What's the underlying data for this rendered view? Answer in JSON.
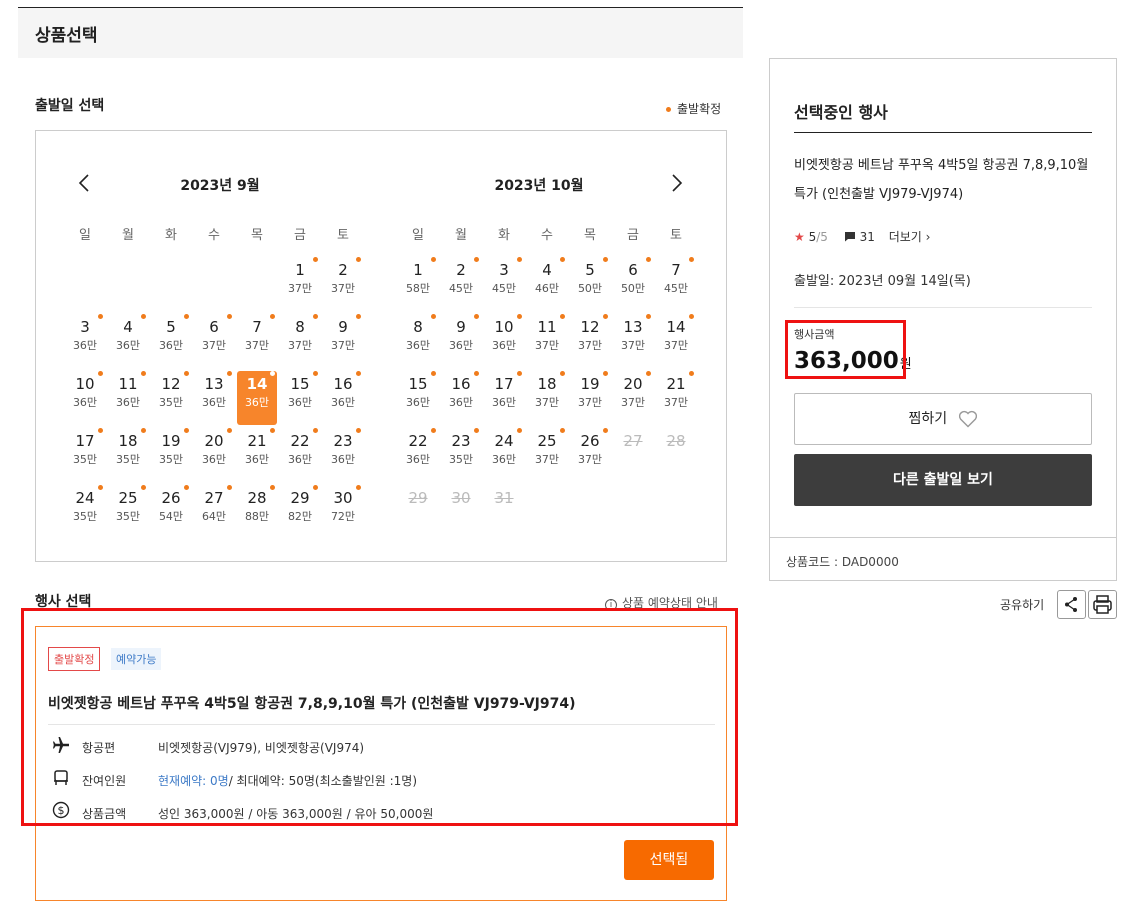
{
  "header": {
    "title": "상품선택"
  },
  "departure": {
    "label": "출발일 선택",
    "legend": "출발확정",
    "calendars": [
      {
        "title": "2023년 9월",
        "weekdays": [
          "일",
          "월",
          "화",
          "수",
          "목",
          "금",
          "토"
        ],
        "days": [
          {
            "day": "1",
            "price": "37만",
            "confirmed": true
          },
          {
            "day": "2",
            "price": "37만",
            "confirmed": true
          },
          {
            "day": "3",
            "price": "36만",
            "confirmed": true
          },
          {
            "day": "4",
            "price": "36만",
            "confirmed": true
          },
          {
            "day": "5",
            "price": "36만",
            "confirmed": true
          },
          {
            "day": "6",
            "price": "37만",
            "confirmed": true
          },
          {
            "day": "7",
            "price": "37만",
            "confirmed": true
          },
          {
            "day": "8",
            "price": "37만",
            "confirmed": true
          },
          {
            "day": "9",
            "price": "37만",
            "confirmed": true
          },
          {
            "day": "10",
            "price": "36만",
            "confirmed": true
          },
          {
            "day": "11",
            "price": "36만",
            "confirmed": true
          },
          {
            "day": "12",
            "price": "35만",
            "confirmed": true
          },
          {
            "day": "13",
            "price": "36만",
            "confirmed": true
          },
          {
            "day": "14",
            "price": "36만",
            "confirmed": true,
            "selected": true
          },
          {
            "day": "15",
            "price": "36만",
            "confirmed": true
          },
          {
            "day": "16",
            "price": "36만",
            "confirmed": true
          },
          {
            "day": "17",
            "price": "35만",
            "confirmed": true
          },
          {
            "day": "18",
            "price": "35만",
            "confirmed": true
          },
          {
            "day": "19",
            "price": "35만",
            "confirmed": true
          },
          {
            "day": "20",
            "price": "36만",
            "confirmed": true
          },
          {
            "day": "21",
            "price": "36만",
            "confirmed": true
          },
          {
            "day": "22",
            "price": "36만",
            "confirmed": true
          },
          {
            "day": "23",
            "price": "36만",
            "confirmed": true
          },
          {
            "day": "24",
            "price": "35만",
            "confirmed": true
          },
          {
            "day": "25",
            "price": "35만",
            "confirmed": true
          },
          {
            "day": "26",
            "price": "54만",
            "confirmed": true
          },
          {
            "day": "27",
            "price": "64만",
            "confirmed": true
          },
          {
            "day": "28",
            "price": "88만",
            "confirmed": true
          },
          {
            "day": "29",
            "price": "82만",
            "confirmed": true
          },
          {
            "day": "30",
            "price": "72만",
            "confirmed": true
          }
        ]
      },
      {
        "title": "2023년 10월",
        "weekdays": [
          "일",
          "월",
          "화",
          "수",
          "목",
          "금",
          "토"
        ],
        "days": [
          {
            "day": "1",
            "price": "58만",
            "confirmed": true
          },
          {
            "day": "2",
            "price": "45만",
            "confirmed": true
          },
          {
            "day": "3",
            "price": "45만",
            "confirmed": true
          },
          {
            "day": "4",
            "price": "46만",
            "confirmed": true
          },
          {
            "day": "5",
            "price": "50만",
            "confirmed": true
          },
          {
            "day": "6",
            "price": "50만",
            "confirmed": true
          },
          {
            "day": "7",
            "price": "45만",
            "confirmed": true
          },
          {
            "day": "8",
            "price": "36만",
            "confirmed": true
          },
          {
            "day": "9",
            "price": "36만",
            "confirmed": true
          },
          {
            "day": "10",
            "price": "36만",
            "confirmed": true
          },
          {
            "day": "11",
            "price": "37만",
            "confirmed": true
          },
          {
            "day": "12",
            "price": "37만",
            "confirmed": true
          },
          {
            "day": "13",
            "price": "37만",
            "confirmed": true
          },
          {
            "day": "14",
            "price": "37만",
            "confirmed": true
          },
          {
            "day": "15",
            "price": "36만",
            "confirmed": true
          },
          {
            "day": "16",
            "price": "36만",
            "confirmed": true
          },
          {
            "day": "17",
            "price": "36만",
            "confirmed": true
          },
          {
            "day": "18",
            "price": "37만",
            "confirmed": true
          },
          {
            "day": "19",
            "price": "37만",
            "confirmed": true
          },
          {
            "day": "20",
            "price": "37만",
            "confirmed": true
          },
          {
            "day": "21",
            "price": "37만",
            "confirmed": true
          },
          {
            "day": "22",
            "price": "36만",
            "confirmed": true
          },
          {
            "day": "23",
            "price": "35만",
            "confirmed": true
          },
          {
            "day": "24",
            "price": "36만",
            "confirmed": true
          },
          {
            "day": "25",
            "price": "37만",
            "confirmed": true
          },
          {
            "day": "26",
            "price": "37만",
            "confirmed": true
          },
          {
            "day": "27",
            "price": "",
            "disabled": true
          },
          {
            "day": "28",
            "price": "",
            "disabled": true
          },
          {
            "day": "29",
            "price": "",
            "disabled": true
          },
          {
            "day": "30",
            "price": "",
            "disabled": true
          },
          {
            "day": "31",
            "price": "",
            "disabled": true
          }
        ]
      }
    ]
  },
  "event_select": {
    "label": "행사 선택",
    "status_info": "상품 예약상태 안내",
    "tags": [
      "출발확정",
      "예약가능"
    ],
    "product_title": "비엣젯항공 베트남 푸꾸옥 4박5일 항공권 7,8,9,10월 특가 (인천출발 VJ979-VJ974)",
    "rows": {
      "flight_key": "항공편",
      "flight_value": "비엣젯항공(VJ979), 비엣젯항공(VJ974)",
      "seats_key": "잔여인원",
      "seats_current": "현재예약: 0명",
      "seats_rest": "/ 최대예약: 50명(최소출발인원 :1명)",
      "price_key": "상품금액",
      "price_value": "성인 363,000원 / 아동 363,000원 / 유아 50,000원"
    },
    "select_button": "선택됨"
  },
  "sidebar": {
    "title": "선택중인 행사",
    "product_name": "비엣젯항공 베트남 푸꾸옥 4박5일 항공권 7,8,9,10월 특가 (인천출발 VJ979-VJ974)",
    "rating": "5",
    "rating_max": "/5",
    "review_count": "31",
    "more": "더보기 ›",
    "departure_date": "출발일: 2023년 09월 14일(목)",
    "price_label": "행사금액",
    "price": "363,000",
    "price_unit": "원",
    "wish_button": "찜하기",
    "other_dates_button": "다른 출발일 보기",
    "product_code": "상품코드 : DAD0000"
  },
  "share": {
    "label": "공유하기"
  },
  "colors": {
    "accent": "#f7852b",
    "dot": "#f07c1c",
    "highlight_box": "#ee1111",
    "dark_button": "#3d3d3d"
  }
}
